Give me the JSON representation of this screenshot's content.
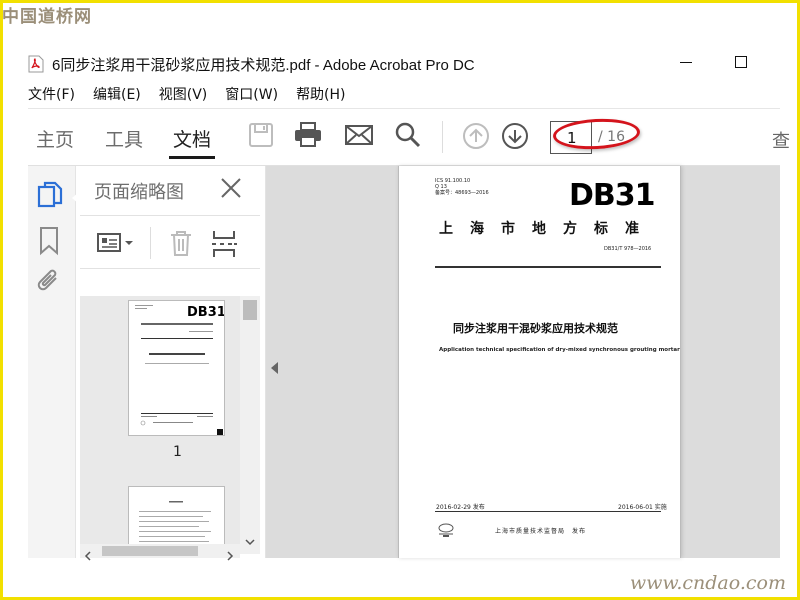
{
  "watermark": {
    "top": "中国道桥网",
    "bottom": "www.cndao.com"
  },
  "window": {
    "title": "6同步注浆用干混砂浆应用技术规范.pdf - Adobe Acrobat Pro DC"
  },
  "menu": [
    {
      "label": "文件(F)"
    },
    {
      "label": "编辑(E)"
    },
    {
      "label": "视图(V)"
    },
    {
      "label": "窗口(W)"
    },
    {
      "label": "帮助(H)"
    }
  ],
  "tabs": [
    {
      "label": "主页"
    },
    {
      "label": "工具"
    },
    {
      "label": "文档"
    }
  ],
  "toolbar": {
    "page_current": "1",
    "page_total": "/ 16",
    "cut_text": "查"
  },
  "panel": {
    "title": "页面缩略图",
    "thumb1_number": "1"
  },
  "pdf_page": {
    "header_lines": [
      "ICS 91.100.10",
      "Q 13",
      "备案号：48693—2016"
    ],
    "code": "DB31",
    "city": "上海市地方标准",
    "standard_no": "DB31/T 978—2016",
    "title_cn": "同步注浆用干混砂浆应用技术规范",
    "title_en": "Application technical specification of dry-mixed synchronous grouting mortar",
    "issue_date": "2016-02-29 发布",
    "impl_date": "2016-06-01 实施",
    "issuer": "上海市质量技术监督局　发布"
  },
  "colors": {
    "accent": "#2b6fd6",
    "highlight": "#d4141c",
    "frame": "#f2e000"
  }
}
